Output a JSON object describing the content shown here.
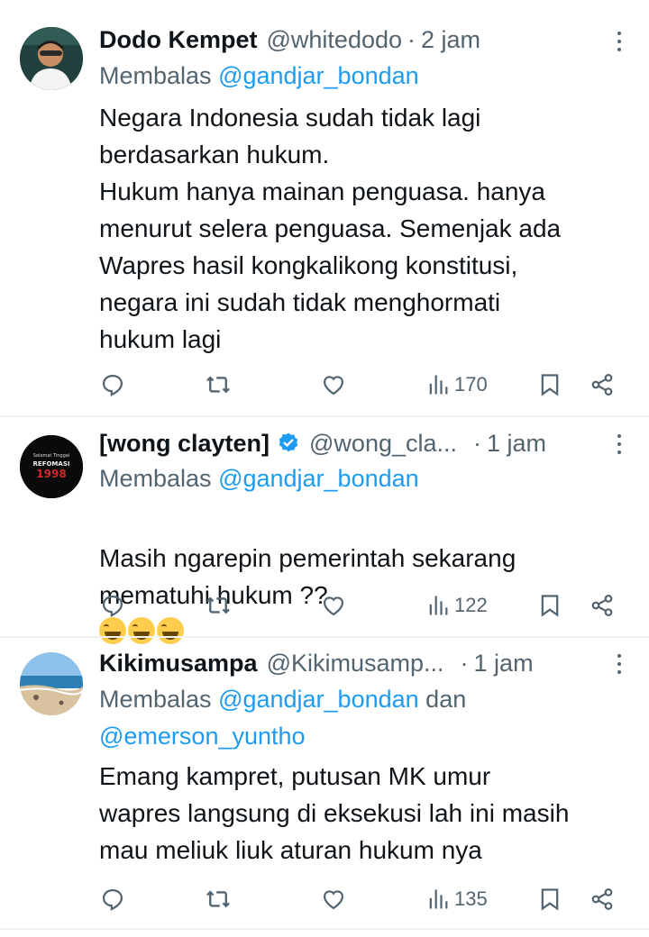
{
  "tweets": [
    {
      "name": "Dodo Kempet",
      "handle": "@whitedodo",
      "time": "2 jam",
      "reply_prefix": "Membalas",
      "reply_to": "@gandjar_bondan",
      "text": "Negara Indonesia sudah tidak lagi\nberdasarkan hukum.\nHukum hanya mainan penguasa. hanya\nmenurut selera penguasa. Semenjak ada\nWapres hasil kongkalikong konstitusi,\nnegara ini sudah tidak menghormati\nhukum lagi",
      "views": "170",
      "avatar_icon": "person-photo"
    },
    {
      "name": "[wong clayten]",
      "handle": "@wong_cla...",
      "time": "1 jam",
      "reply_prefix": "Membalas",
      "reply_to": "@gandjar_bondan",
      "text": "Masih ngarepin pemerintah sekarang\nmematuhi hukum ??",
      "views": "122",
      "avatar_line1": "Selamat Tinggal",
      "avatar_line2": "REFOMASI",
      "avatar_line3": "1998"
    },
    {
      "name": "Kikimusampa",
      "handle": "@Kikimusamp...",
      "time": "1 jam",
      "reply_prefix": "Membalas",
      "reply_to": "@gandjar_bondan",
      "reply_and": "dan",
      "reply_to_2": "@emerson_yuntho",
      "text": "Emang kampret, putusan MK umur\nwapres langsung di eksekusi lah ini masih\nmau meliuk liuk aturan hukum nya",
      "views": "135",
      "avatar_icon": "beach-photo"
    }
  ],
  "dot": "·",
  "colors": {
    "text": "#0f1419",
    "secondary": "#536471",
    "link": "#1d9bf0",
    "divider": "#eff3f4"
  }
}
